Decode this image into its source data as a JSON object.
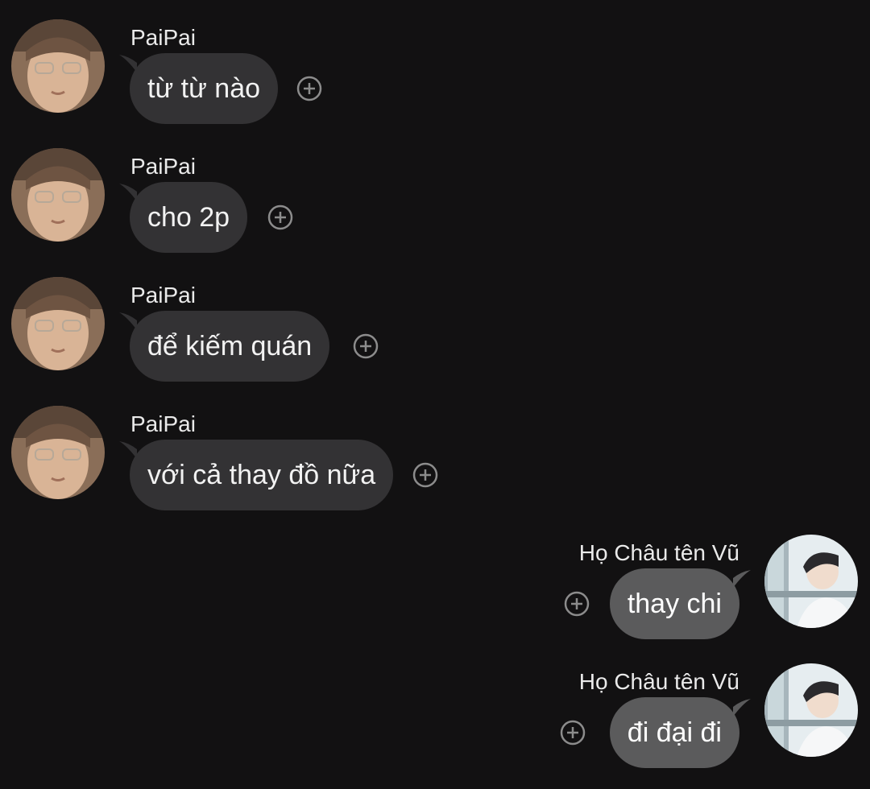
{
  "messages": [
    {
      "sender": "PaiPai",
      "text": "từ từ nào",
      "side": "incoming",
      "avatar_icon": "paipai-avatar-icon",
      "reaction_icon": "add-reaction-icon"
    },
    {
      "sender": "PaiPai",
      "text": "cho 2p",
      "side": "incoming",
      "avatar_icon": "paipai-avatar-icon",
      "reaction_icon": "add-reaction-icon"
    },
    {
      "sender": "PaiPai",
      "text": "để kiếm quán",
      "side": "incoming",
      "avatar_icon": "paipai-avatar-icon",
      "reaction_icon": "add-reaction-icon"
    },
    {
      "sender": "PaiPai",
      "text": "với cả thay đồ nữa",
      "side": "incoming",
      "avatar_icon": "paipai-avatar-icon",
      "reaction_icon": "add-reaction-icon"
    },
    {
      "sender": "Họ Châu tên Vũ",
      "text": "thay chi",
      "side": "outgoing",
      "avatar_icon": "vu-avatar-icon",
      "reaction_icon": "add-reaction-icon"
    },
    {
      "sender": "Họ Châu tên Vũ",
      "text": "đi đại đi",
      "side": "outgoing",
      "avatar_icon": "vu-avatar-icon",
      "reaction_icon": "add-reaction-icon"
    }
  ],
  "colors": {
    "background": "#121112",
    "incoming_bubble": "#333234",
    "outgoing_bubble": "#5b5b5c",
    "text": "#ffffff"
  }
}
